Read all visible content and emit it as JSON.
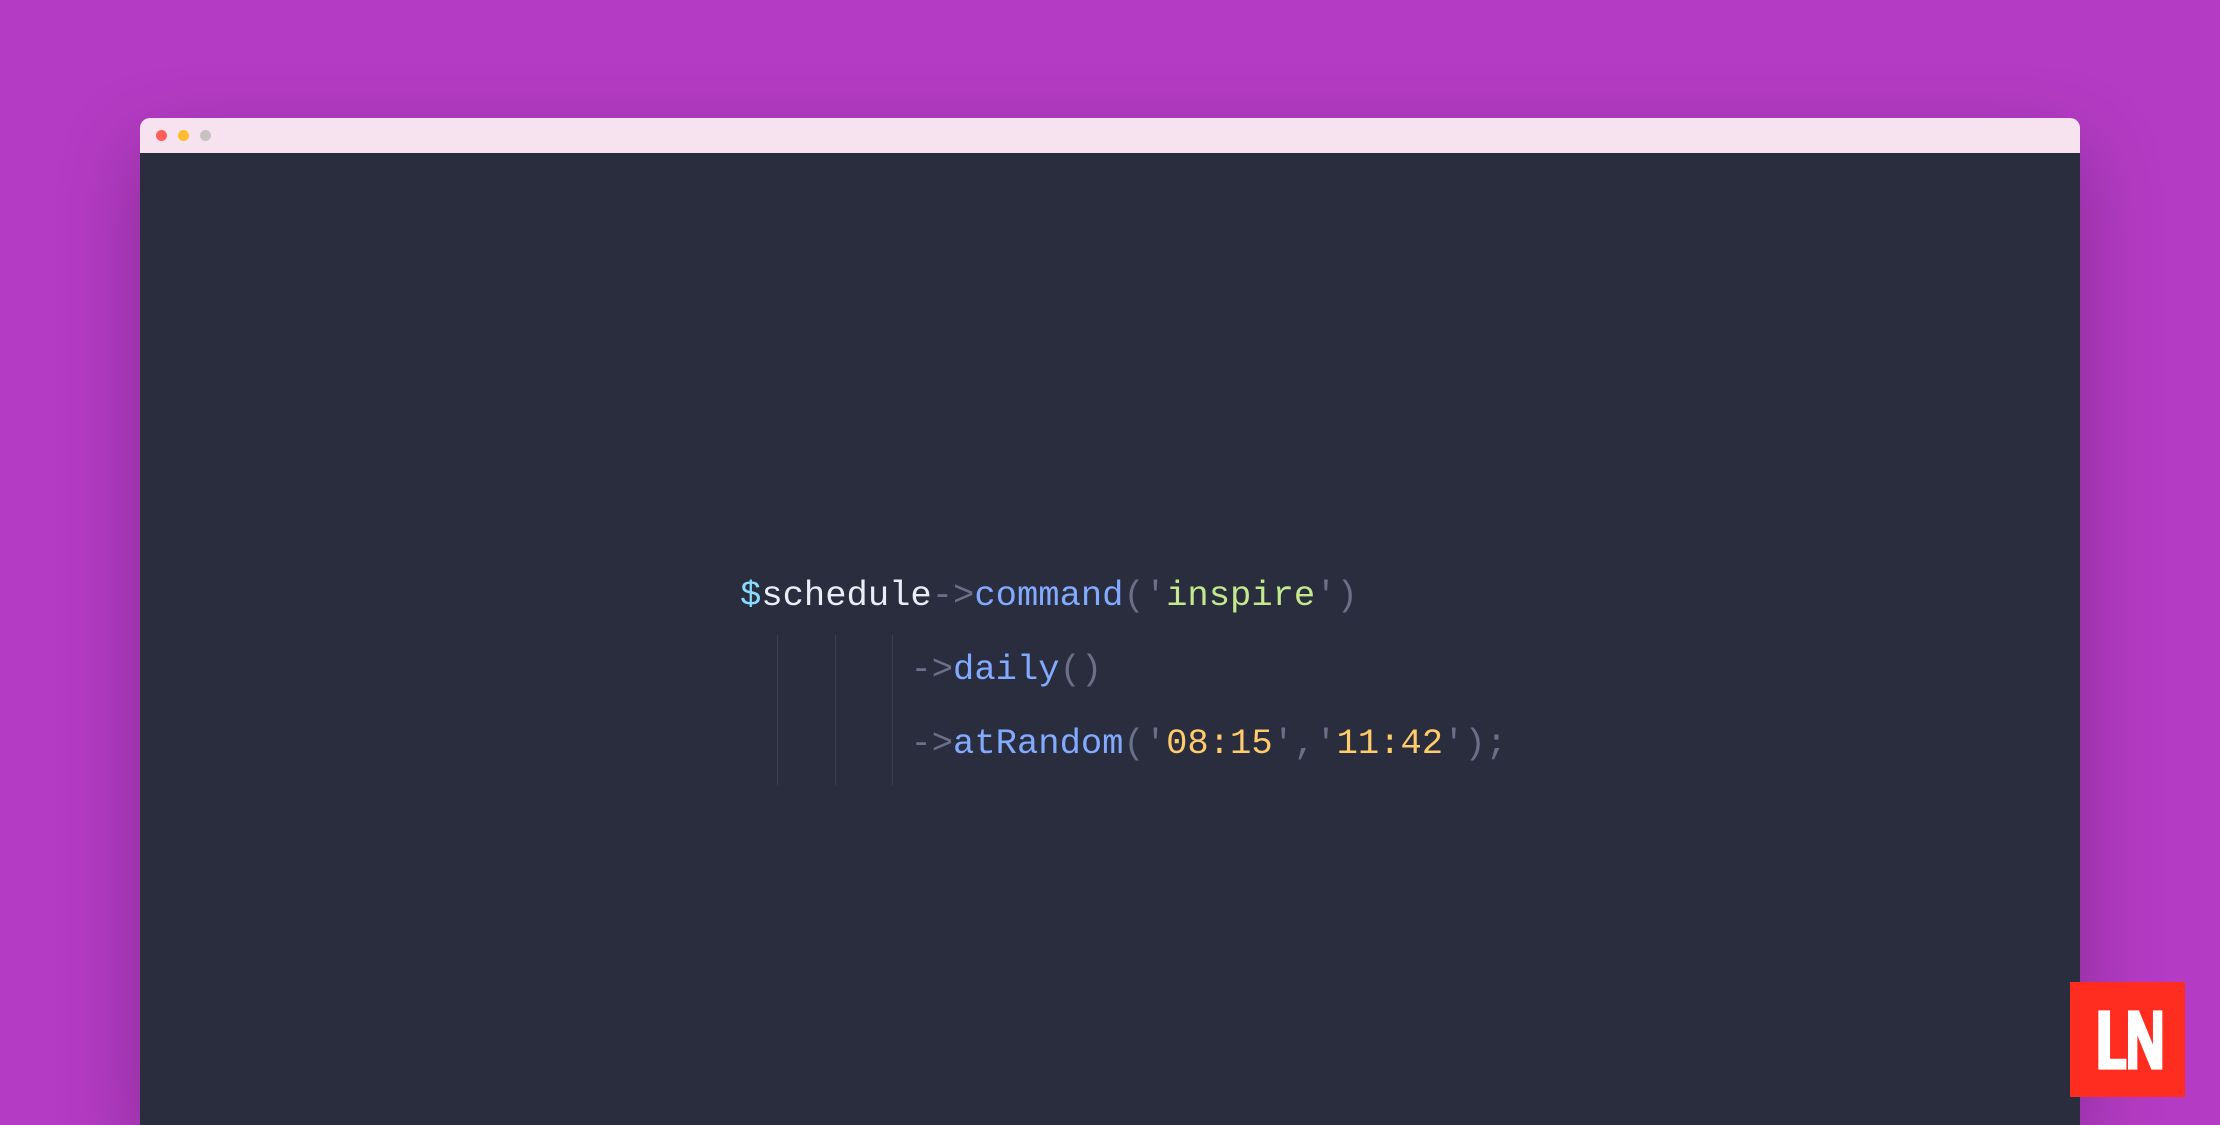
{
  "colors": {
    "page_bg": "#b43bc4",
    "titlebar_bg": "#f6e3ef",
    "editor_bg": "#292d3e",
    "logo_bg": "#ff2d20",
    "dot_close": "#ff5f57",
    "dot_min": "#febc2e",
    "dot_max": "#c7c1c1"
  },
  "code": {
    "line1": {
      "dollar": "$",
      "var": "schedule",
      "arrow1": "->",
      "m1": "command",
      "lp": "(",
      "q1a": "'",
      "s1": "inspire",
      "q1b": "'",
      "rp": ")"
    },
    "line2": {
      "indent": "        ",
      "arrow": "->",
      "m": "daily",
      "lp": "(",
      "rp": ")"
    },
    "line3": {
      "indent": "        ",
      "arrow": "->",
      "m": "atRandom",
      "lp": "(",
      "q1a": "'",
      "s1": "08:15",
      "q1b": "'",
      "comma": ",",
      "q2a": "'",
      "s2": "11:42",
      "q2b": "'",
      "rp": ")",
      "semi": ";"
    }
  },
  "logo_text": "LN"
}
